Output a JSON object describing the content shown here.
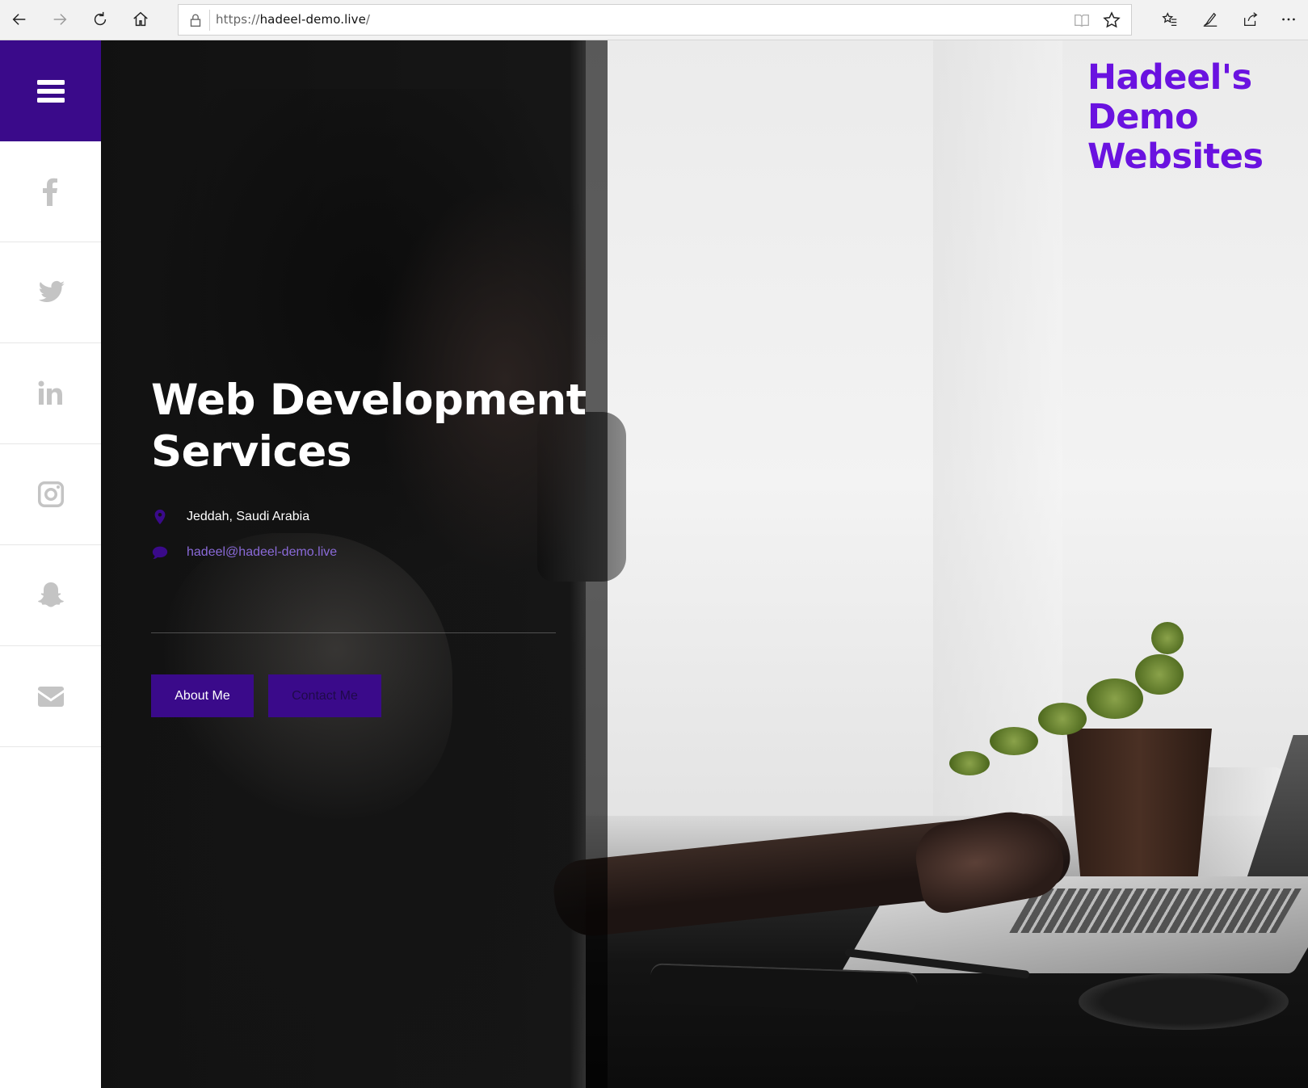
{
  "browser": {
    "url_prefix": "https://",
    "url_host": "hadeel-demo.live",
    "url_path": "/",
    "buttons": [
      "back",
      "forward",
      "refresh",
      "home"
    ],
    "tools": [
      "favorites",
      "notes",
      "share",
      "more"
    ]
  },
  "sidebar": {
    "menu_icon": "hamburger-icon",
    "menu_bg": "#3a0a8a",
    "socials": [
      {
        "name": "facebook",
        "icon": "facebook-icon"
      },
      {
        "name": "twitter",
        "icon": "twitter-icon"
      },
      {
        "name": "linkedin",
        "icon": "linkedin-icon"
      },
      {
        "name": "instagram",
        "icon": "instagram-icon"
      },
      {
        "name": "snapchat",
        "icon": "snapchat-icon"
      },
      {
        "name": "email",
        "icon": "envelope-icon"
      }
    ]
  },
  "hero": {
    "title_line1": "Web Development",
    "title_line2": "Services",
    "location": "Jeddah, Saudi Arabia",
    "email": "hadeel@hadeel-demo.live",
    "about_button": "About Me",
    "contact_button": "Contact Me"
  },
  "brand": {
    "line1": "Hadeel's",
    "line2": "Demo",
    "line3": "Websites",
    "color": "#6a12e0"
  },
  "colors": {
    "accent": "#3a0a8a",
    "link": "#8a6ad8"
  }
}
